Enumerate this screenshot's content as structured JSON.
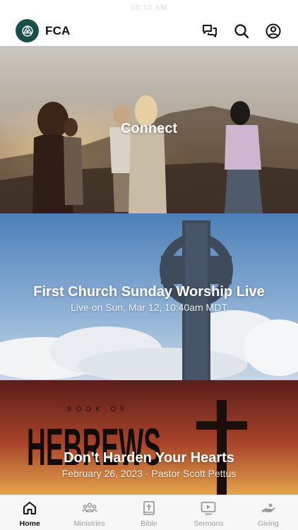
{
  "status_bar": {
    "time": "10:10 AM"
  },
  "header": {
    "app_title": "FCA",
    "actions": [
      "chat-icon",
      "search-icon",
      "profile-icon"
    ],
    "logo_color": "#184f4a"
  },
  "cards": [
    {
      "title": "Connect",
      "subtitle": ""
    },
    {
      "title": "First Church Sunday Worship Live",
      "subtitle": "Live on Sun, Mar 12, 10:40am MDT"
    },
    {
      "title": "Don't Harden Your Hearts",
      "subtitle": "February 26, 2023 · Pastor Scott Pettus",
      "artwork_text": {
        "top": "BOOK OF",
        "main": "HEBREWS"
      }
    }
  ],
  "tabs": [
    {
      "label": "Home",
      "icon": "home-icon",
      "active": true
    },
    {
      "label": "Ministries",
      "icon": "people-icon",
      "active": false
    },
    {
      "label": "Bible",
      "icon": "bible-icon",
      "active": false
    },
    {
      "label": "Sermons",
      "icon": "video-icon",
      "active": false
    },
    {
      "label": "Giving",
      "icon": "giving-icon",
      "active": false
    }
  ]
}
